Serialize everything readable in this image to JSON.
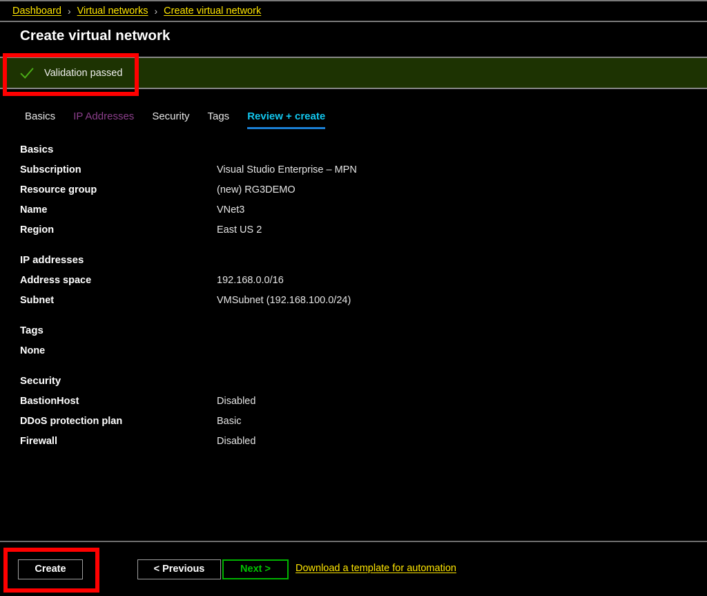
{
  "breadcrumb": {
    "separator": "›",
    "items": [
      {
        "label": "Dashboard"
      },
      {
        "label": "Virtual networks"
      },
      {
        "label": "Create virtual network"
      }
    ]
  },
  "header": {
    "title": "Create virtual network"
  },
  "banner": {
    "text": "Validation passed",
    "icon": "check-icon",
    "background_color": "#1d3302",
    "icon_color": "#4caf17"
  },
  "tabs": [
    {
      "label": "Basics",
      "state": "normal"
    },
    {
      "label": "IP Addresses",
      "state": "visited"
    },
    {
      "label": "Security",
      "state": "normal"
    },
    {
      "label": "Tags",
      "state": "normal"
    },
    {
      "label": "Review + create",
      "state": "active"
    }
  ],
  "review": {
    "sections": [
      {
        "heading": "Basics",
        "rows": [
          {
            "label": "Subscription",
            "value": "Visual Studio Enterprise – MPN"
          },
          {
            "label": "Resource group",
            "value": "(new) RG3DEMO"
          },
          {
            "label": "Name",
            "value": "VNet3"
          },
          {
            "label": "Region",
            "value": "East US 2"
          }
        ]
      },
      {
        "heading": "IP addresses",
        "rows": [
          {
            "label": "Address space",
            "value": "192.168.0.0/16"
          },
          {
            "label": "Subnet",
            "value": "VMSubnet (192.168.100.0/24)"
          }
        ]
      },
      {
        "heading": "Tags",
        "note": "None",
        "rows": []
      },
      {
        "heading": "Security",
        "rows": [
          {
            "label": "BastionHost",
            "value": "Disabled"
          },
          {
            "label": "DDoS protection plan",
            "value": "Basic"
          },
          {
            "label": "Firewall",
            "value": "Disabled"
          }
        ]
      }
    ]
  },
  "actions": {
    "create_label": "Create",
    "previous_label": "< Previous",
    "next_label": "Next >",
    "download_label": "Download a template for automation"
  },
  "colors": {
    "accent_cyan": "#12c8f0",
    "tab_underline": "#1a7fd4",
    "link_yellow": "#ffe600",
    "visited_purple": "#8c3f8c",
    "next_green": "#00b400",
    "annotation_red": "#ff0000",
    "banner_green": "#1d3302"
  }
}
